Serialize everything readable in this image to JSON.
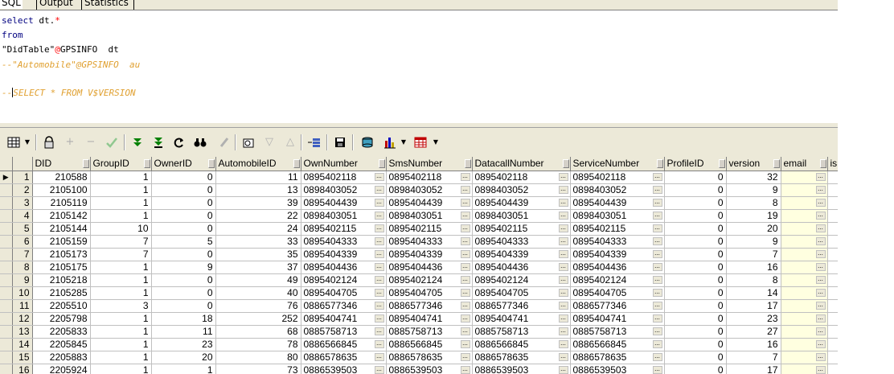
{
  "tabs": [
    {
      "label": "SQL"
    },
    {
      "label": "Output"
    },
    {
      "label": "Statistics"
    }
  ],
  "editor": {
    "line1_kw": "select",
    "line1_rest": " dt.",
    "line1_star": "*",
    "line2": "from",
    "line3_str": "\"DidTable\"",
    "line3_at": "@",
    "line3_rest": "GPSINFO  dt",
    "line4": "--\"Automobile\"@GPSINFO  au",
    "line5_dash": "--",
    "line5_rest": "SELECT * FROM V$VERSION"
  },
  "toolbar": {
    "icons": [
      "grid-menu-icon",
      "lock-icon",
      "add-record-icon",
      "delete-record-icon",
      "post-edit-icon",
      "fetch-next-icon",
      "fetch-last-icon",
      "refresh-icon",
      "find-icon",
      "clear-icon",
      "query-by-example-icon",
      "filter-icon",
      "sort-icon",
      "record-view-icon",
      "save-icon",
      "export-icon",
      "chart-icon",
      "table-view-icon"
    ]
  },
  "grid": {
    "columns": [
      "DID",
      "GroupID",
      "OwnerID",
      "AutomobileID",
      "OwnNumber",
      "SmsNumber",
      "DatacallNumber",
      "ServiceNumber",
      "ProfileID",
      "version",
      "email",
      "is"
    ],
    "rows": [
      [
        "1",
        "210588",
        "1",
        "0",
        "11",
        "0895402118",
        "0895402118",
        "0895402118",
        "0895402118",
        "0",
        "32"
      ],
      [
        "2",
        "2105100",
        "1",
        "0",
        "13",
        "0898403052",
        "0898403052",
        "0898403052",
        "0898403052",
        "0",
        "9"
      ],
      [
        "3",
        "2105119",
        "1",
        "0",
        "39",
        "0895404439",
        "0895404439",
        "0895404439",
        "0895404439",
        "0",
        "8"
      ],
      [
        "4",
        "2105142",
        "1",
        "0",
        "22",
        "0898403051",
        "0898403051",
        "0898403051",
        "0898403051",
        "0",
        "19"
      ],
      [
        "5",
        "2105144",
        "10",
        "0",
        "24",
        "0895402115",
        "0895402115",
        "0895402115",
        "0895402115",
        "0",
        "20"
      ],
      [
        "6",
        "2105159",
        "7",
        "5",
        "33",
        "0895404333",
        "0895404333",
        "0895404333",
        "0895404333",
        "0",
        "9"
      ],
      [
        "7",
        "2105173",
        "7",
        "0",
        "35",
        "0895404339",
        "0895404339",
        "0895404339",
        "0895404339",
        "0",
        "7"
      ],
      [
        "8",
        "2105175",
        "1",
        "9",
        "37",
        "0895404436",
        "0895404436",
        "0895404436",
        "0895404436",
        "0",
        "16"
      ],
      [
        "9",
        "2105218",
        "1",
        "0",
        "49",
        "0895402124",
        "0895402124",
        "0895402124",
        "0895402124",
        "0",
        "8"
      ],
      [
        "10",
        "2105285",
        "1",
        "0",
        "40",
        "0895404705",
        "0895404705",
        "0895404705",
        "0895404705",
        "0",
        "14"
      ],
      [
        "11",
        "2205510",
        "3",
        "0",
        "76",
        "0886577346",
        "0886577346",
        "0886577346",
        "0886577346",
        "0",
        "17"
      ],
      [
        "12",
        "2205798",
        "1",
        "18",
        "252",
        "0895404741",
        "0895404741",
        "0895404741",
        "0895404741",
        "0",
        "23"
      ],
      [
        "13",
        "2205833",
        "1",
        "11",
        "68",
        "0885758713",
        "0885758713",
        "0885758713",
        "0885758713",
        "0",
        "27"
      ],
      [
        "14",
        "2205845",
        "1",
        "23",
        "78",
        "0886566845",
        "0886566845",
        "0886566845",
        "0886566845",
        "0",
        "16"
      ],
      [
        "15",
        "2205883",
        "1",
        "20",
        "80",
        "0886578635",
        "0886578635",
        "0886578635",
        "0886578635",
        "0",
        "7"
      ],
      [
        "16",
        "2205924",
        "1",
        "1",
        "73",
        "0886539503",
        "0886539503",
        "0886539503",
        "0886539503",
        "0",
        "17"
      ]
    ]
  }
}
